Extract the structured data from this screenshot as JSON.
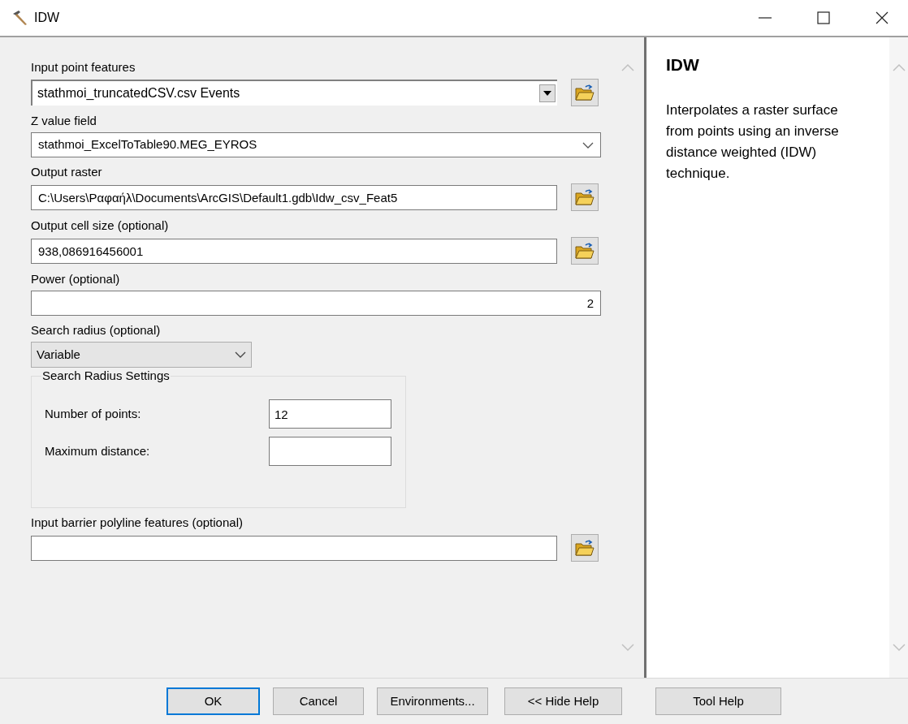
{
  "window": {
    "title": "IDW"
  },
  "parameters": [
    {
      "kind": "combo",
      "label": "Input point features",
      "value": "stathmoi_truncatedCSV.csv Events",
      "browse": true
    },
    {
      "kind": "dropdown",
      "label": "Z value field",
      "value": "stathmoi_ExcelToTable90.MEG_EYROS"
    },
    {
      "kind": "text",
      "label": "Output raster",
      "value": "C:\\Users\\Ραφαήλ\\Documents\\ArcGIS\\Default1.gdb\\Idw_csv_Feat5",
      "browse": true
    },
    {
      "kind": "text",
      "label": "Output cell size (optional)",
      "value": "938,086916456001",
      "browse": true
    },
    {
      "kind": "number",
      "label": "Power (optional)",
      "value": "2"
    },
    {
      "kind": "select",
      "label": "Search radius (optional)",
      "value": "Variable"
    },
    {
      "kind": "group",
      "label": "Search Radius Settings",
      "fields": [
        {
          "label": "Number of points:",
          "value": "12"
        },
        {
          "label": "Maximum distance:"
        }
      ]
    },
    {
      "kind": "text",
      "label": "Input barrier polyline features (optional)",
      "browse": true
    }
  ],
  "help": {
    "title": "IDW",
    "text": "Interpolates a raster surface from points using an inverse distance weighted (IDW) technique."
  },
  "buttons": [
    {
      "label": "OK",
      "default": true
    },
    {
      "label": "Cancel",
      "default": false
    },
    {
      "label": "Environments...",
      "default": false
    },
    {
      "label": "<< Hide Help",
      "default": false
    },
    {
      "label": "Tool Help",
      "default": false
    }
  ]
}
